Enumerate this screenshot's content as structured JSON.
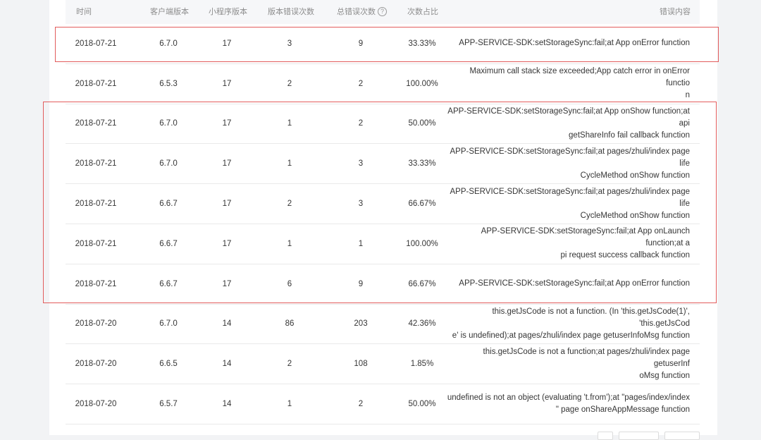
{
  "table": {
    "headers": {
      "time": "时间",
      "client_version": "客户端版本",
      "mini_version": "小程序版本",
      "version_errors": "版本错误次数",
      "total_errors": "总错误次数",
      "ratio": "次数占比",
      "content": "错误内容"
    },
    "help_icon": "help-circle-icon",
    "rows": [
      {
        "date": "2018-07-21",
        "client": "6.7.0",
        "mini": "17",
        "verr": "3",
        "total": "9",
        "ratio": "33.33%",
        "msg1": "APP-SERVICE-SDK:setStorageSync:fail;at App onError function",
        "msg2": ""
      },
      {
        "date": "2018-07-21",
        "client": "6.5.3",
        "mini": "17",
        "verr": "2",
        "total": "2",
        "ratio": "100.00%",
        "msg1": "Maximum call stack size exceeded;App catch error in onError functio",
        "msg2": "n"
      },
      {
        "date": "2018-07-21",
        "client": "6.7.0",
        "mini": "17",
        "verr": "1",
        "total": "2",
        "ratio": "50.00%",
        "msg1": "APP-SERVICE-SDK:setStorageSync:fail;at App onShow function;at api",
        "msg2": "getShareInfo fail callback function"
      },
      {
        "date": "2018-07-21",
        "client": "6.7.0",
        "mini": "17",
        "verr": "1",
        "total": "3",
        "ratio": "33.33%",
        "msg1": "APP-SERVICE-SDK:setStorageSync:fail;at pages/zhuli/index page life",
        "msg2": "CycleMethod onShow function"
      },
      {
        "date": "2018-07-21",
        "client": "6.6.7",
        "mini": "17",
        "verr": "2",
        "total": "3",
        "ratio": "66.67%",
        "msg1": "APP-SERVICE-SDK:setStorageSync:fail;at pages/zhuli/index page life",
        "msg2": "CycleMethod onShow function"
      },
      {
        "date": "2018-07-21",
        "client": "6.6.7",
        "mini": "17",
        "verr": "1",
        "total": "1",
        "ratio": "100.00%",
        "msg1": "APP-SERVICE-SDK:setStorageSync:fail;at App onLaunch function;at a",
        "msg2": "pi request success callback function"
      },
      {
        "date": "2018-07-21",
        "client": "6.6.7",
        "mini": "17",
        "verr": "6",
        "total": "9",
        "ratio": "66.67%",
        "msg1": "APP-SERVICE-SDK:setStorageSync:fail;at App onError function",
        "msg2": ""
      },
      {
        "date": "2018-07-20",
        "client": "6.7.0",
        "mini": "14",
        "verr": "86",
        "total": "203",
        "ratio": "42.36%",
        "msg1": "this.getJsCode is not a function. (In 'this.getJsCode(1)', 'this.getJsCod",
        "msg2": "e' is undefined);at pages/zhuli/index page getuserInfoMsg function"
      },
      {
        "date": "2018-07-20",
        "client": "6.6.5",
        "mini": "14",
        "verr": "2",
        "total": "108",
        "ratio": "1.85%",
        "msg1": "this.getJsCode is not a function;at pages/zhuli/index page getuserInf",
        "msg2": "oMsg function"
      },
      {
        "date": "2018-07-20",
        "client": "6.5.7",
        "mini": "14",
        "verr": "1",
        "total": "2",
        "ratio": "50.00%",
        "msg1": "undefined is not an object (evaluating 't.from');at \"pages/index/index",
        "msg2": "\" page onShareAppMessage function"
      }
    ]
  },
  "annotation_color": "#e25c5c"
}
